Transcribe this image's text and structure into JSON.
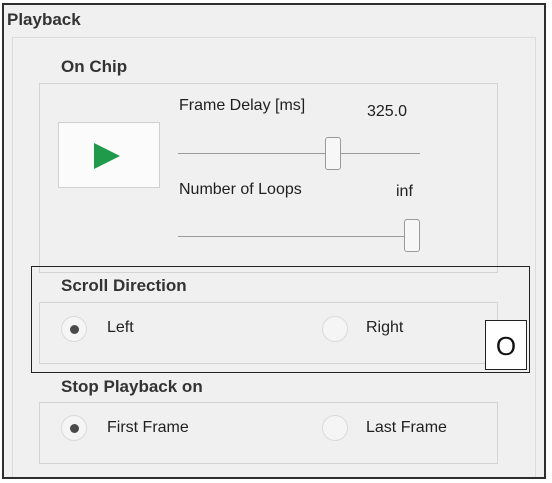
{
  "panel": {
    "title": "Playback"
  },
  "on_chip": {
    "title": "On Chip",
    "play_icon_color": "#1e9a4a",
    "frame_delay": {
      "label": "Frame Delay [ms]",
      "value": "325.0",
      "slider_fraction": 0.65
    },
    "loops": {
      "label": "Number of Loops",
      "value": "inf",
      "slider_fraction": 1.0
    }
  },
  "scroll_direction": {
    "title": "Scroll Direction",
    "options": [
      {
        "label": "Left",
        "selected": true
      },
      {
        "label": "Right",
        "selected": false
      }
    ]
  },
  "stop_playback": {
    "title": "Stop Playback on",
    "options": [
      {
        "label": "First Frame",
        "selected": true
      },
      {
        "label": "Last Frame",
        "selected": false
      }
    ]
  },
  "marker": {
    "text": "O"
  }
}
